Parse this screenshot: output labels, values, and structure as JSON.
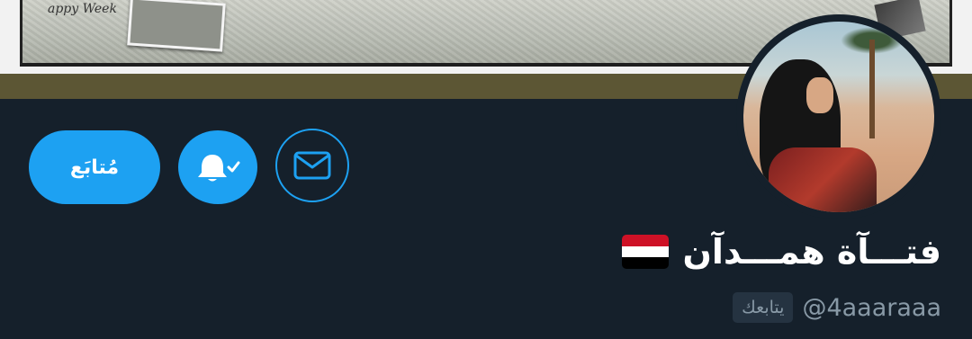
{
  "profile": {
    "display_name": "فتـــآة همـــدآن",
    "handle": "@4aaaraaa",
    "follows_you": "يتابعك",
    "flag_emoji": "yemen-flag",
    "banner_caption": "appy Week"
  },
  "actions": {
    "follow_label": "مُتابَع",
    "bell_icon": "bell-check-icon",
    "message_icon": "envelope-icon"
  },
  "colors": {
    "background": "#15202b",
    "accent": "#1da1f2",
    "banner_border": "#5c5634",
    "muted": "#8899a6",
    "flag_red": "#ce1126",
    "flag_white": "#ffffff",
    "flag_black": "#000000"
  }
}
